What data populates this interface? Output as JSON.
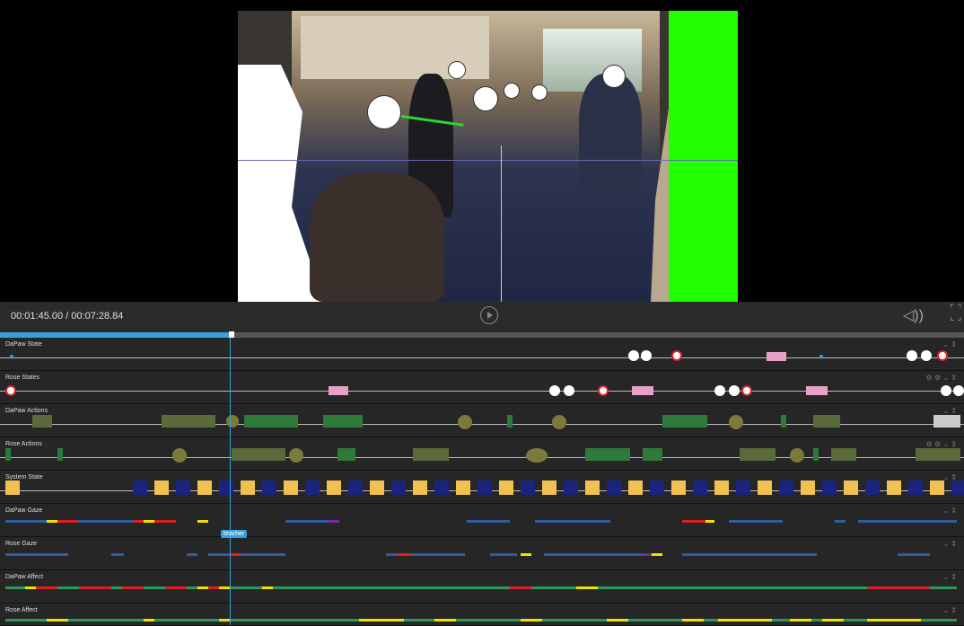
{
  "player": {
    "time_display": "00:01:45.00 / 00:07:28.84",
    "icons": {
      "play": "play-icon",
      "volume": "volume-icon",
      "fullscreen": "fullscreen-icon"
    },
    "progress": 0.24
  },
  "tooltip": {
    "label": "teacher"
  },
  "tracks": [
    {
      "name": "DaPaw State"
    },
    {
      "name": "Rose States"
    },
    {
      "name": "DaPaw Actions"
    },
    {
      "name": "Rose Actions"
    },
    {
      "name": "System State"
    },
    {
      "name": "DaPaw Gaze"
    },
    {
      "name": "Rose Gaze"
    },
    {
      "name": "DaPaw Affect"
    },
    {
      "name": "Rose Affect"
    }
  ],
  "colors": {
    "accent": "#3aa0dc",
    "gaze_blue": "#2f5c9e",
    "gaze_yellow": "#f0e000",
    "gaze_red": "#e02020",
    "affect_green": "#2a9a5a",
    "state_yellow": "#f0c050",
    "state_blue": "#1a237e",
    "action_olive": "#7a7a3a",
    "action_green": "#2f7a3a"
  }
}
